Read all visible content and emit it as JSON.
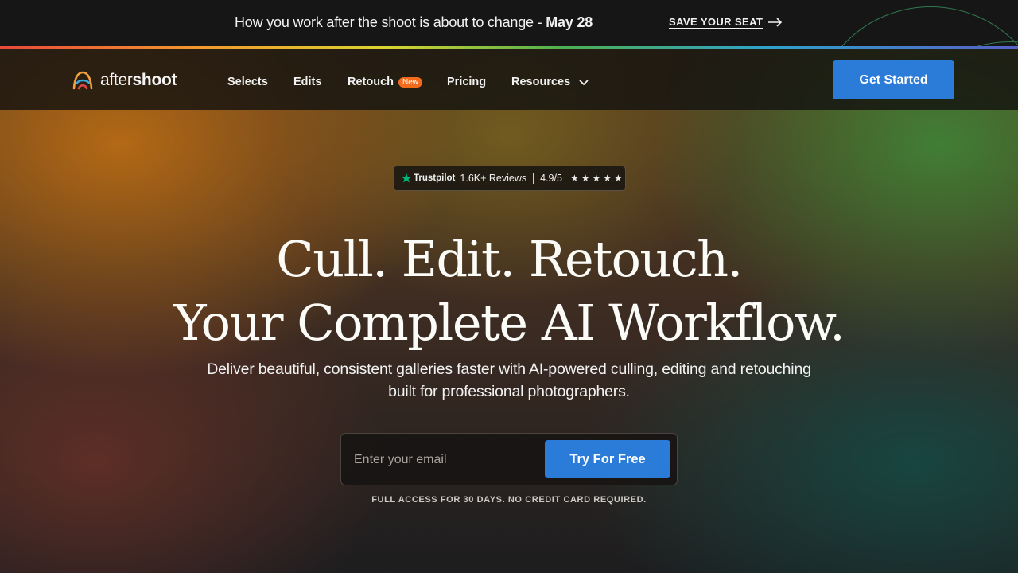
{
  "announcement": {
    "text": "How you work after the shoot is about to change - ",
    "date": "May 28",
    "cta": "SAVE YOUR SEAT"
  },
  "logo": {
    "text_light": "after",
    "text_bold": "shoot"
  },
  "nav": {
    "items": [
      {
        "label": "Selects"
      },
      {
        "label": "Edits"
      },
      {
        "label": "Retouch",
        "badge": "New"
      },
      {
        "label": "Pricing"
      },
      {
        "label": "Resources"
      }
    ],
    "cta": "Get Started"
  },
  "trustpilot": {
    "brand": "Trustpilot",
    "reviews": "1.6K+ Reviews",
    "rating": "4.9/5",
    "stars": 5
  },
  "hero": {
    "line1": "Cull. Edit. Retouch.",
    "line2": "Your Complete AI Workflow.",
    "subtitle_line1": "Deliver beautiful, consistent galleries faster with AI-powered culling, editing and retouching",
    "subtitle_line2": "built for professional photographers."
  },
  "signup": {
    "placeholder": "Enter your email",
    "button": "Try For Free",
    "fineprint": "FULL ACCESS FOR 30 DAYS. NO CREDIT CARD REQUIRED."
  },
  "colors": {
    "accent_blue": "#2b7bd9",
    "badge_orange": "#f26a1b",
    "trustpilot_green": "#00b67a"
  }
}
